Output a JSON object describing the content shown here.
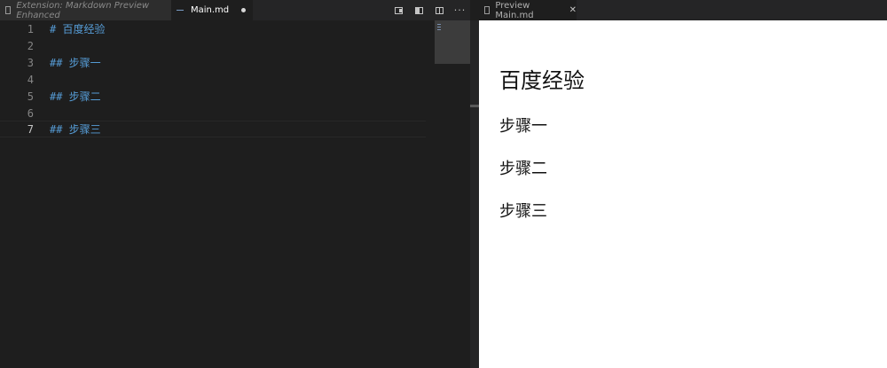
{
  "tabs": {
    "extension_tab": "Extension: Markdown Preview Enhanced",
    "main_tab": "Main.md",
    "preview_tab": "Preview Main.md"
  },
  "editor": {
    "lines": [
      {
        "num": "1",
        "text": "# 百度经验"
      },
      {
        "num": "2",
        "text": ""
      },
      {
        "num": "3",
        "text": "## 步骤一"
      },
      {
        "num": "4",
        "text": ""
      },
      {
        "num": "5",
        "text": "## 步骤二"
      },
      {
        "num": "6",
        "text": ""
      },
      {
        "num": "7",
        "text": "## 步骤三"
      }
    ],
    "active_line": 7
  },
  "preview": {
    "h1": "百度经验",
    "h2": [
      "步骤一",
      "步骤二",
      "步骤三"
    ]
  },
  "colors": {
    "editor_bg": "#1e1e1e",
    "heading_syntax": "#569cd6",
    "preview_bg": "#ffffff"
  },
  "icons": [
    "file-icon",
    "markdown-file-icon",
    "unsaved-dot-icon",
    "open-preview-icon",
    "preview-side-icon",
    "split-editor-icon",
    "more-actions-icon",
    "close-icon"
  ]
}
